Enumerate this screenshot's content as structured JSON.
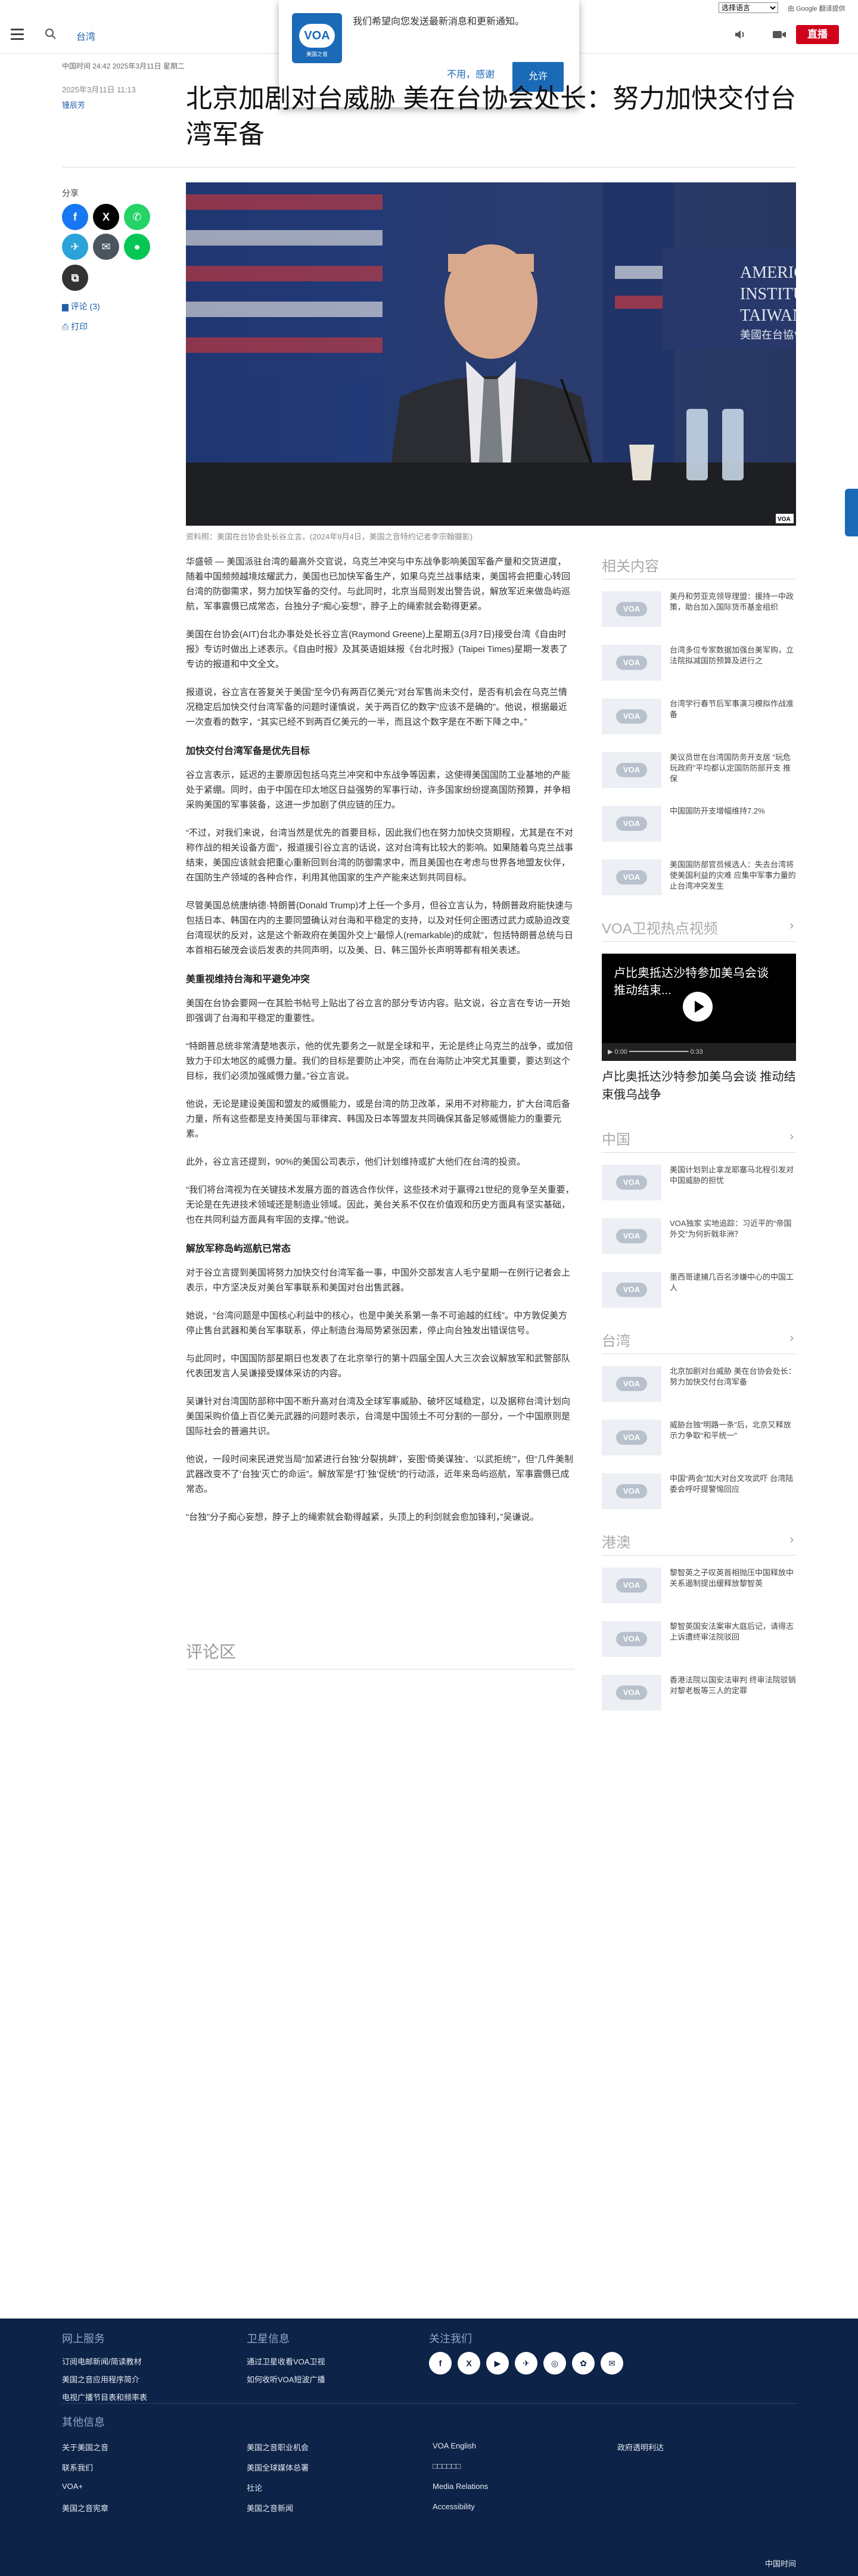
{
  "header": {
    "section": "台湾",
    "lang_select": "选择语言",
    "translate_label": "由 Google 翻译提供",
    "live": "直播"
  },
  "notification": {
    "message": "我们希望向您发送最新消息和更新通知。",
    "logo": "VOA",
    "logo_sub": "美国之音",
    "deny": "不用，感谢",
    "allow": "允许"
  },
  "article": {
    "meta": "中国时间 24:42 2025年3月11日 星期二",
    "date": "2025年3月11日 11:13",
    "author": "锺辰芳",
    "headline": "北京加剧对台威胁 美在台协会处长：努力加快交付台湾军备",
    "share_label": "分享",
    "comments_link": "评论 (3)",
    "print_link": "打印",
    "hero_sign": "AMERICAN INSTITUTE IN TAIWAN",
    "hero_sign_cn": "美國在台協會",
    "caption": "资料照：美国在台协会处长谷立言。(2024年9月4日，美国之音特约记者李宗翰摄影)",
    "paragraphs": [
      "华盛顿 — 美国派驻台湾的最高外交官说，乌克兰冲突与中东战争影响美国军备产量和交货进度，随着中国频频越境炫耀武力，美国也已加快军备生产，如果乌克兰战事结束，美国将会把重心转回台湾的防御需求，努力加快军备的交付。与此同时，北京当局则发出警告说，解放军近来做岛屿巡航，军事震慑已成常态，台独分子“痴心妄想”，脖子上的绳索就会勒得更紧。",
      "美国在台协会(AIT)台北办事处处长谷立言(Raymond Greene)上星期五(3月7日)接受台湾《自由时报》专访时做出上述表示。《自由时报》及其英语姐妹报《台北时报》(Taipei Times)星期一发表了专访的报道和中文全文。",
      "报道说，谷立言在答复关于美国“至今仍有两百亿美元”对台军售尚未交付，是否有机会在乌克兰情况稳定后加快交付台湾军备的问题时谨慎说，关于两百亿的数字“应该不是确的”。他说，根据最近一次查看的数字，“其实已经不到两百亿美元的一半，而且这个数字是在不断下降之中。”"
    ],
    "h1": "加快交付台湾军备是优先目标",
    "paragraphs2": [
      "谷立言表示，延迟的主要原因包括乌克兰冲突和中东战争等因素，这使得美国国防工业基地的产能处于紧绷。同时，由于中国在印太地区日益强势的军事行动，许多国家纷纷提高国防预算，并争相采购美国的军事装备，这进一步加剧了供应链的压力。",
      "“不过，对我们来说，台湾当然是优先的首要目标，因此我们也在努力加快交货期程，尤其是在不对称作战的相关设备方面”，报道援引谷立言的话说，这对台湾有比较大的影响。如果随着乌克兰战事结束，美国应该就会把重心重新回到台湾的防御需求中，而且美国也在考虑与世界各地盟友伙伴，在国防生产领域的各种合作，利用其他国家的生产产能来达到共同目标。",
      "尽管美国总统唐纳德·特朗普(Donald Trump)才上任一个多月，但谷立言认为，特朗普政府能快速与包括日本、韩国在内的主要同盟确认对台海和平稳定的支持，以及对任何企图透过武力或胁迫改变台湾现状的反对，这是这个新政府在美国外交上“最惊人(remarkable)的成就”，包括特朗普总统与日本首相石破茂会谈后发表的共同声明，以及美、日、韩三国外长声明等都有相关表述。"
    ],
    "h2": "美重视维持台海和平避免冲突",
    "paragraphs3": [
      "美国在台协会要网一在其脸书帖号上贴出了谷立言的部分专访内容。贴文说，谷立言在专访一开始即强调了台海和平稳定的重要性。",
      "“特朗普总统非常清楚地表示，他的优先要务之一就是全球和平，无论是终止乌克兰的战争，或加倍致力于印太地区的威慑力量。我们的目标是要防止冲突，而在台海防止冲突尤其重要，要达到这个目标，我们必须加强威慑力量。”谷立言说。",
      "他说，无论是建设美国和盟友的威慑能力，或是台湾的防卫改革，采用不对称能力，扩大台湾后备力量，所有这些都是支持美国与菲律宾、韩国及日本等盟友共同确保其备足够威慑能力的重要元素。",
      "此外，谷立言还提到，90%的美国公司表示，他们计划维持或扩大他们在台湾的投资。",
      "“我们将台湾视为在关键技术发展方面的首选合作伙伴，这些技术对于赢得21世纪的竞争至关重要，无论是在先进技术领域还是制造业领域。因此，美台关系不仅在价值观和历史方面具有坚实基础，也在共同利益方面具有牢固的支撑。”他说。"
    ],
    "h3": "解放军称岛屿巡航已常态",
    "paragraphs4": [
      "对于谷立言提到美国将努力加快交付台湾军备一事，中国外交部发言人毛宁星期一在例行记者会上表示，中方坚决反对美台军事联系和美国对台出售武器。",
      "她说，“台湾问题是中国核心利益中的核心，也是中美关系第一条不可逾越的红线”。中方敦促美方停止售台武器和美台军事联系，停止制造台海局势紧张因素，停止向台独发出错误信号。",
      "与此同时，中国国防部星期日也发表了在北京举行的第十四届全国人大三次会议解放军和武警部队代表团发言人吴谦接受媒体采访的内容。",
      "吴谦针对台湾国防部称中国不断升高对台湾及全球军事威胁、破坏区域稳定，以及据称台湾计划向美国采购价值上百亿美元武器的问题时表示，台湾是中国领土不可分割的一部分，一个中国原则是国际社会的普遍共识。",
      "他说，一段时间来民进党当局“加紧进行台独‘分裂挑衅’，妄图‘倚美谋独’、‘以武拒统’”，但“几件美制武器改变不了‘台独’灭亡的命运”。解放军是“打‘独’促统”的行动派，近年来岛屿巡航，军事震慑已成常态。",
      "“台独”分子痴心妄想，脖子上的绳索就会勒得越紧，头顶上的利剑就会愈加锋利，”吴谦说。"
    ],
    "comments_title": "评论区"
  },
  "sidebar": {
    "related_title": "相关内容",
    "related": [
      "美丹和劳亚克领导理盟：援持一中政策，助台加入国际货币基金组织",
      "台湾多位专家数据加强台美军购，立法院拟减国防预算及进行之",
      "台湾学行春节后军事演习模拟作战准备",
      "美议员世在台湾国防务开支居 “玩危玩政府”平均都认定国防防部开支 推保",
      "中国国防开支增幅维持7.2%",
      "美国国防部官员候选人：失去台湾将使美国利益的灾难 应集中军事力量的止台湾冲突发生"
    ],
    "video_title": "VOA卫视热点视频",
    "video_overlay": "卢比奥抵达沙特参加美乌会谈 推动结束...",
    "video_time": "0:00",
    "video_dur": "0:33",
    "video_caption": "卢比奥抵达沙特参加美乌会谈 推动结束俄乌战争",
    "china_title": "中国",
    "china": [
      "美国计划到止拿龙耶塞马北程引发对中国威胁的担忧",
      "VOA独家 实地追踪：习近平的“帝国外交”为何折戟非洲？",
      "墨西哥逮捕几百名涉嫌中心的中国工人"
    ],
    "taiwan_title": "台湾",
    "taiwan": [
      "北京加剧对台威胁 美在台协会处长：努力加快交付台湾军备",
      "威胁台独“明路一条”后，北京又释放示力争取“和平统一”",
      "中国“两会”加大对台文攻武吓 台湾陆委会呼吁提警惕回应"
    ],
    "hk_title": "港澳",
    "hk": [
      "黎智英之子叹英首相抛压中国释放中关系遏制提出缓释放黎智英",
      "黎智英国安法案审大庭后记，请得志上诉遭终审法院驳回",
      "香港法院以国安法审判 终审法院驳销对黎老板等三人的定罪"
    ],
    "thumb_logo": "VOA"
  },
  "footer": {
    "col1_title": "网上服务",
    "col1": [
      "订阅电邮新闻/简读教材",
      "美国之音应用程序简介",
      "电视广播节目表和频率表"
    ],
    "col2_title": "卫星信息",
    "col2": [
      "通过卫星收看VOA卫视",
      "如何收听VOA短波广播"
    ],
    "col3_title": "关注我们",
    "social": [
      "f",
      "X",
      "▶",
      "✈",
      "◎",
      "✿",
      "✉"
    ],
    "other_title": "其他信息",
    "other": [
      [
        "关于美国之音",
        "美国之音职业机会",
        "VOA English",
        "政府透明利达"
      ],
      [
        "联系我们",
        "美国全球媒体总署",
        "□□□□□□",
        ""
      ],
      [
        "VOA+",
        "社论",
        "Media Relations",
        ""
      ],
      [
        "美国之音宪章",
        "美国之音新闻",
        "Accessibility",
        ""
      ]
    ],
    "copyright": "中国时间"
  },
  "colors": {
    "brand": "#1b6ab8",
    "live": "#d0021b",
    "footer_bg": "#0d2347"
  }
}
